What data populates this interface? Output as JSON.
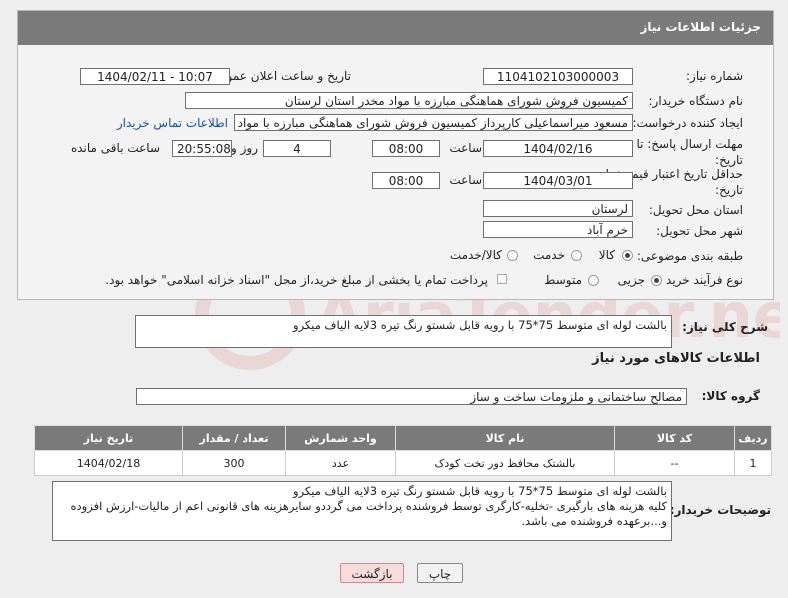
{
  "header": {
    "title": "جزئیات اطلاعات نیاز"
  },
  "fields": {
    "need_number_label": "شماره نیاز:",
    "need_number": "1104102103000003",
    "announce_label": "تاریخ و ساعت اعلان عمومی:",
    "announce_value": "1404/02/11 - 10:07",
    "buyer_org_label": "نام دستگاه خریدار:",
    "buyer_org": "کمیسیون فروش شورای هماهنگی مبارزه با مواد مخدر استان لرستان",
    "requester_label": "ایجاد کننده درخواست:",
    "requester": "مسعود میراسماعیلی کارپرداز کمیسیون فروش شورای هماهنگی مبارزه با مواد مخدر",
    "contact_link": "اطلاعات تماس خریدار",
    "deadline_label": "مهلت ارسال پاسخ: تا تاریخ:",
    "deadline_date": "1404/02/16",
    "time_label": "ساعت",
    "deadline_time": "08:00",
    "days_value": "4",
    "days_label": "روز و",
    "remaining_value": "20:55:08",
    "remaining_label": "ساعت باقی مانده",
    "validity_label": "حداقل تاریخ اعتبار قیمت: تا تاریخ:",
    "validity_date": "1404/03/01",
    "validity_time": "08:00",
    "province_label": "استان محل تحویل:",
    "province": "لرستان",
    "city_label": "شهر محل تحویل:",
    "city": "خرم آباد",
    "category_label": "طبقه بندی موضوعی:",
    "category_options": [
      "کالا",
      "خدمت",
      "کالا/خدمت"
    ],
    "process_label": "نوع فرآیند خرید :",
    "process_options": [
      "جزیی",
      "متوسط"
    ],
    "payment_note": "پرداخت تمام یا بخشی از مبلغ خرید،از محل \"اسناد خزانه اسلامی\" خواهد بود."
  },
  "summary": {
    "label": "شرح کلی نیاز:",
    "text": "بالشت لوله ای متوسط 75*75 با رویه قابل شستو رنگ تیره 3لایه الیاف میکرو"
  },
  "goods": {
    "title": "اطلاعات کالاهای مورد نیاز",
    "group_label": "گروه کالا:",
    "group_value": "مصالح ساختمانی و ملزومات ساخت و ساز",
    "columns": [
      "ردیف",
      "کد کالا",
      "نام کالا",
      "واحد شمارش",
      "تعداد / مقدار",
      "تاریخ نیاز"
    ],
    "rows": [
      [
        "1",
        "--",
        "بالشتک محافظ دور تخت کودک",
        "عدد",
        "300",
        "1404/02/18"
      ]
    ]
  },
  "buyer_notes": {
    "label": "توضیحات خریدار:",
    "lines": [
      "بالشت لوله ای متوسط 75*75 با رویه قابل شستو رنگ تیره 3لایه الیاف میکرو",
      "کلیه هزینه های بارگیری -تخلیه-کارگری توسط فروشنده پرداخت می گرددو سایرهزینه های قانونی اعم از مالیات-ارزش افزوده",
      "و...برعهده فروشنده می باشد."
    ]
  },
  "buttons": {
    "print": "چاپ",
    "back": "بازگشت"
  },
  "watermark": "AriaTender.neT"
}
